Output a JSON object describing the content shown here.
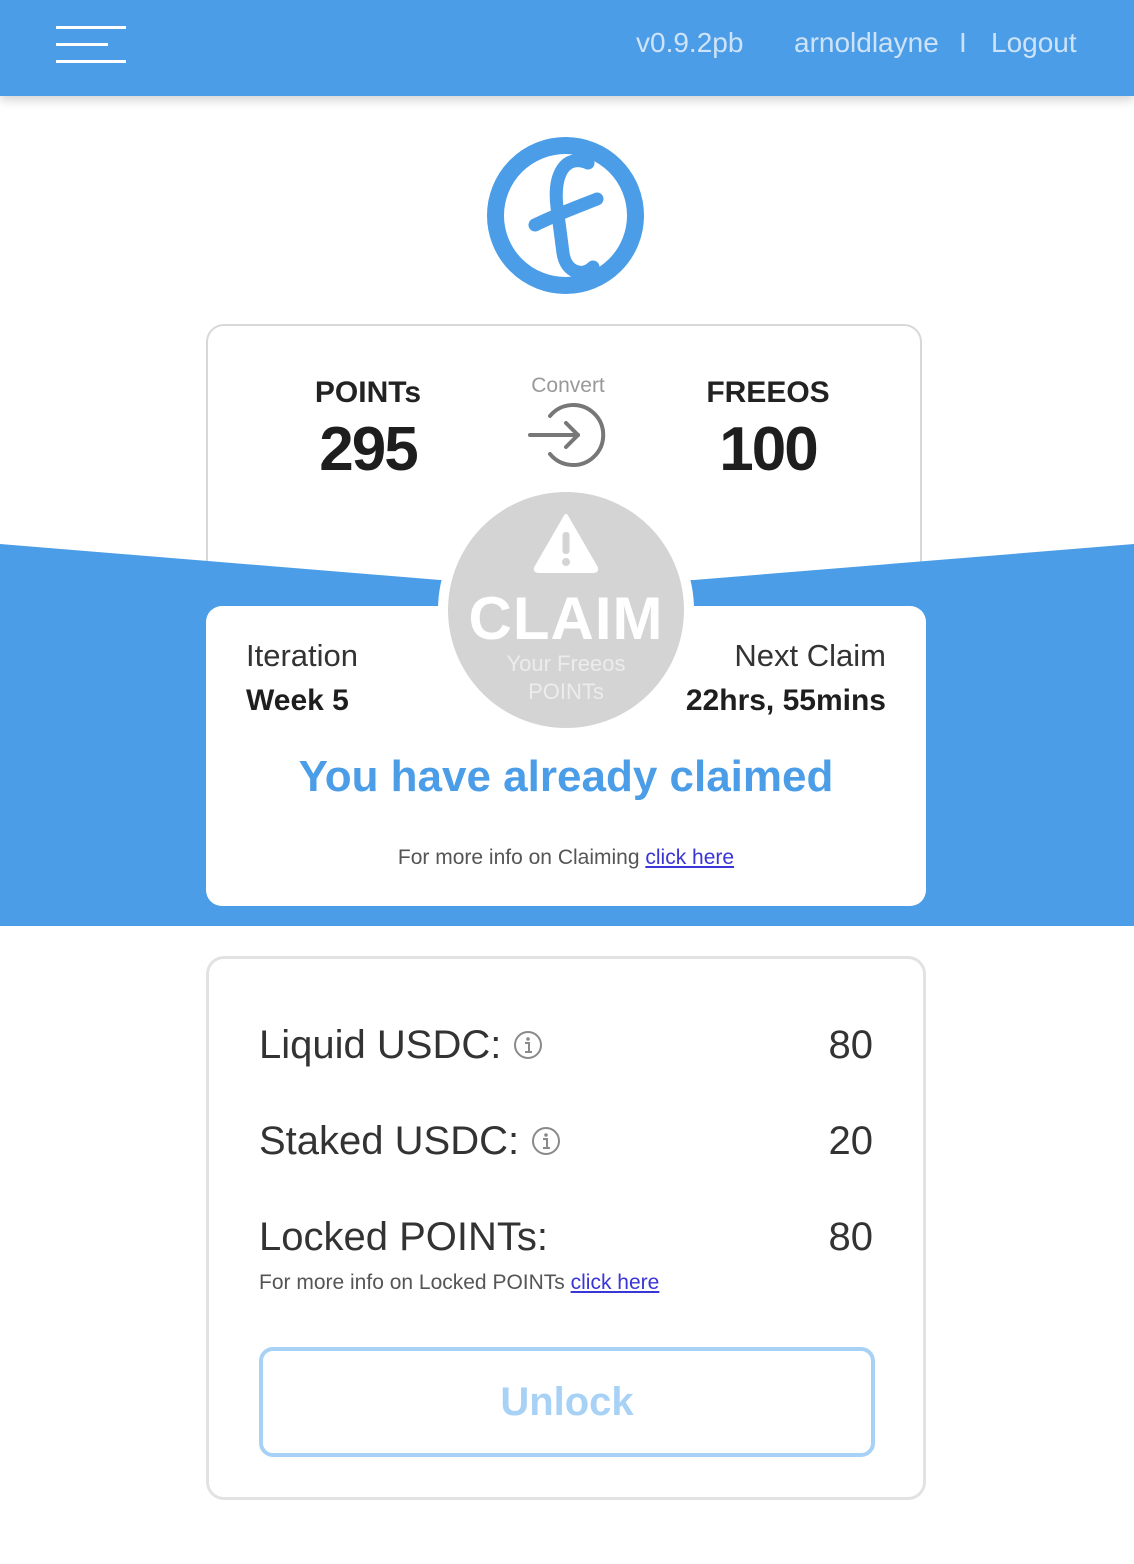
{
  "header": {
    "version": "v0.9.2pb",
    "username": "arnoldlayne",
    "separator": "I",
    "logout_label": "Logout"
  },
  "icons": {
    "menu": "hamburger-menu-icon",
    "logo": "freeos-logo-icon",
    "convert": "arrow-into-circle-icon",
    "claim_warning": "warning-triangle-icon",
    "info": "info-circle-icon"
  },
  "colors": {
    "accent": "#4a9de6",
    "disabled_button": "#a8d2f5",
    "claim_disabled": "#d4d4d4"
  },
  "balances": {
    "points_label": "POINTs",
    "points_value": "295",
    "convert_label": "Convert",
    "freeos_label": "FREEOS",
    "freeos_value": "100"
  },
  "claim": {
    "button_title": "CLAIM",
    "button_sub_1": "Your Freeos",
    "button_sub_2": "POINTs",
    "iteration_label": "Iteration",
    "iteration_value": "Week 5",
    "next_claim_label": "Next Claim",
    "next_claim_value": "22hrs, 55mins",
    "status_message": "You have already claimed",
    "info_text": "For more info on Claiming ",
    "info_link": "click here"
  },
  "wallet": {
    "liquid_label": "Liquid USDC:",
    "liquid_value": "80",
    "staked_label": "Staked USDC:",
    "staked_value": "20",
    "locked_label": "Locked POINTs:",
    "locked_value": "80",
    "locked_info_text": "For more info on Locked POINTs ",
    "locked_info_link": "click here",
    "unlock_label": "Unlock"
  }
}
